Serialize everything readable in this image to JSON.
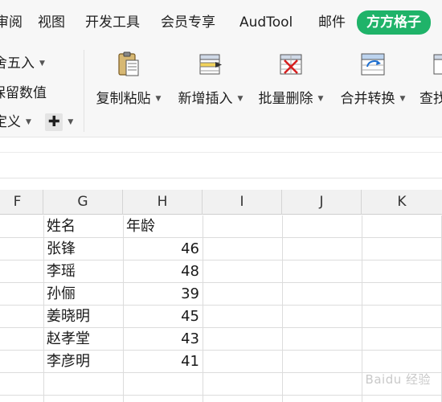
{
  "menu": {
    "items": [
      "审阅",
      "视图",
      "开发工具",
      "会员专享",
      "AudTool",
      "邮件"
    ],
    "brand_tab": "方方格子"
  },
  "ribbon": {
    "left": {
      "round_label": "舍五入",
      "keep_value_label": "保留数值",
      "custom_label": "定义",
      "plus_symbol": "✚"
    },
    "buttons": [
      {
        "label": "复制粘贴",
        "icon": "clipboard-paste-icon"
      },
      {
        "label": "新增插入",
        "icon": "insert-row-icon"
      },
      {
        "label": "批量删除",
        "icon": "delete-table-icon"
      },
      {
        "label": "合并转换",
        "icon": "merge-convert-icon"
      },
      {
        "label": "查找",
        "icon": "find-icon"
      }
    ]
  },
  "grid": {
    "columns": [
      "F",
      "G",
      "H",
      "I",
      "J",
      "K"
    ],
    "header_row": {
      "name": "姓名",
      "age": "年龄"
    },
    "rows": [
      {
        "name": "张锋",
        "age": "46"
      },
      {
        "name": "李瑶",
        "age": "48"
      },
      {
        "name": "孙俪",
        "age": "39"
      },
      {
        "name": "姜晓明",
        "age": "45"
      },
      {
        "name": "赵孝堂",
        "age": "43"
      },
      {
        "name": "李彦明",
        "age": "41"
      }
    ]
  },
  "watermark": "Baidu 经验",
  "colors": {
    "brand": "#1fb369",
    "grid_line": "#dcdcdc",
    "header_bg": "#f1f1f1"
  }
}
